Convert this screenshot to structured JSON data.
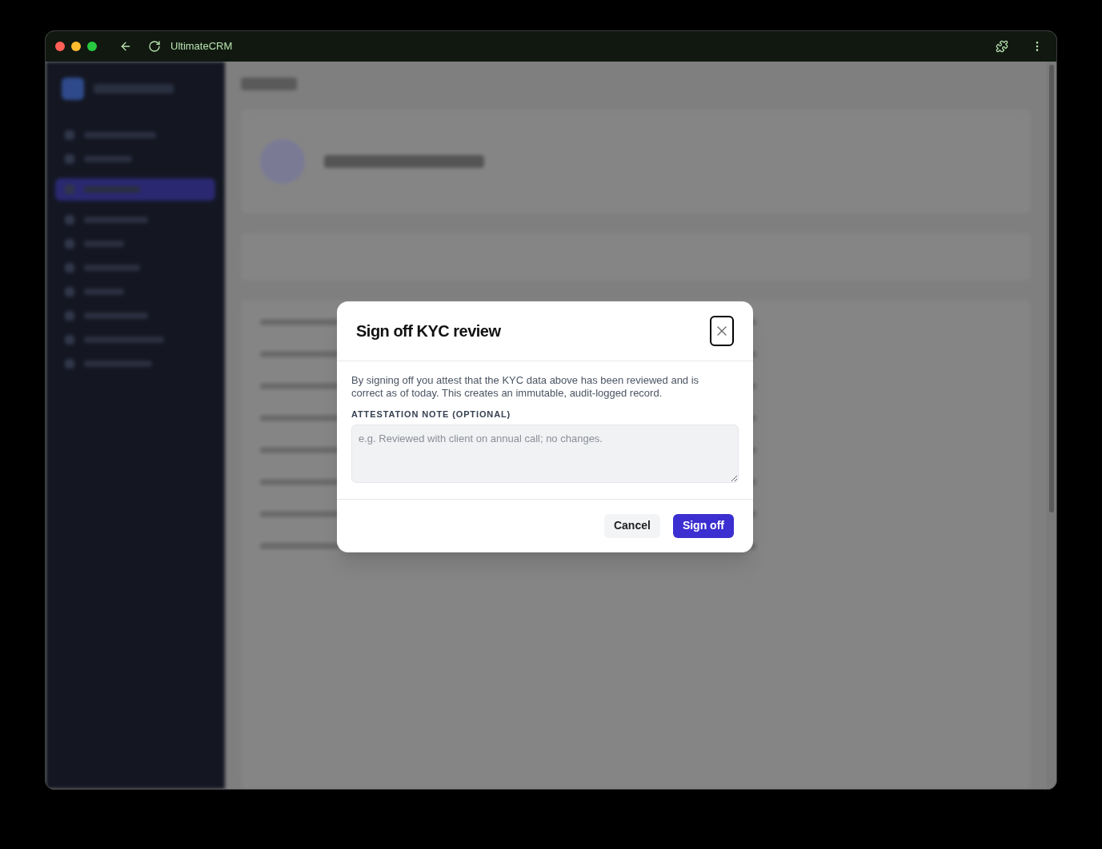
{
  "browser": {
    "title": "UltimateCRM"
  },
  "dialog": {
    "title": "Sign off KYC review",
    "description": "By signing off you attest that the KYC data above has been reviewed and is correct as of today. This creates an immutable, audit-logged record.",
    "note_label": "ATTESTATION NOTE (OPTIONAL)",
    "note_placeholder": "e.g. Reviewed with client on annual call; no changes.",
    "buttons": [
      {
        "label": "Cancel",
        "kind": "secondary"
      },
      {
        "label": "Sign off",
        "kind": "primary"
      }
    ]
  }
}
